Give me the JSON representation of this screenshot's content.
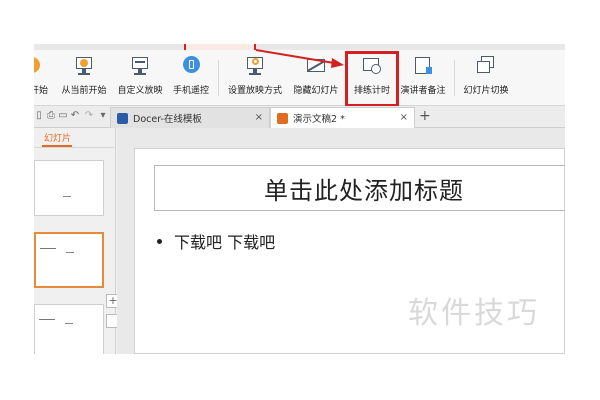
{
  "ribbon": {
    "items": [
      {
        "label": "开始"
      },
      {
        "label": "从当前开始"
      },
      {
        "label": "自定义放映"
      },
      {
        "label": "手机遥控"
      },
      {
        "label": "设置放映方式"
      },
      {
        "label": "隐藏幻灯片"
      },
      {
        "label": "排练计时"
      },
      {
        "label": "演讲者备注"
      },
      {
        "label": "幻灯片切换"
      }
    ]
  },
  "tabs": {
    "docer": {
      "label": "Docer-在线模板"
    },
    "doc2": {
      "label": "演示文稿2 *"
    },
    "close": "×",
    "add": "+"
  },
  "panel": {
    "slides_tab": "幻灯片",
    "plus": "+"
  },
  "slide": {
    "title": "单击此处添加标题",
    "bullet": "下载吧  下载吧"
  },
  "watermark": "软件技巧",
  "colors": {
    "highlight": "#d42020",
    "accent": "#e26b1f"
  }
}
